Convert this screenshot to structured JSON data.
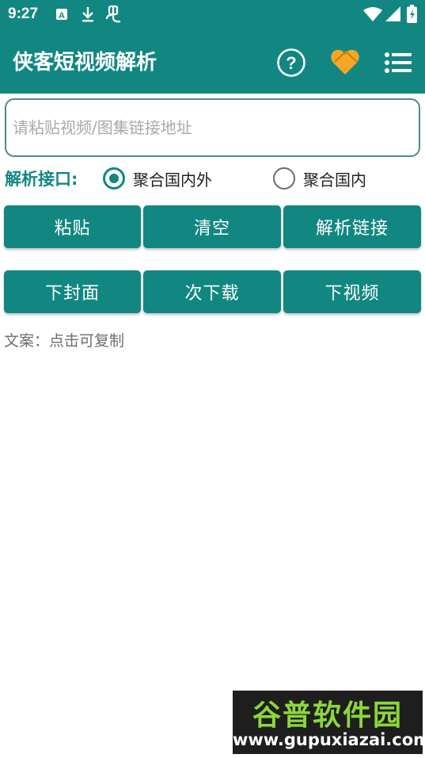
{
  "status_bar": {
    "time": "9:27",
    "icons": [
      "a-letter-icon",
      "download-icon",
      "bug-icon",
      "wifi-icon",
      "signal-icon",
      "battery-icon"
    ]
  },
  "app_bar": {
    "title": "侠客短视频解析",
    "actions": [
      "help-icon",
      "heart-icon",
      "menu-list-icon"
    ],
    "accent_color": "#128782",
    "heart_color": "#f5a623"
  },
  "url_input": {
    "value": "",
    "placeholder": "请粘贴视频/图集链接地址"
  },
  "api_selector": {
    "label": "解析接口:",
    "options": [
      {
        "label": "聚合国内外",
        "selected": true
      },
      {
        "label": "聚合国内",
        "selected": false
      }
    ]
  },
  "buttons_row1": [
    "粘贴",
    "清空",
    "解析链接"
  ],
  "buttons_row2": [
    "下封面",
    "次下载",
    "下视频"
  ],
  "caption": "文案：点击可复制",
  "watermark": {
    "title": "谷普软件园",
    "url": "www.gupuxiazai.com"
  }
}
